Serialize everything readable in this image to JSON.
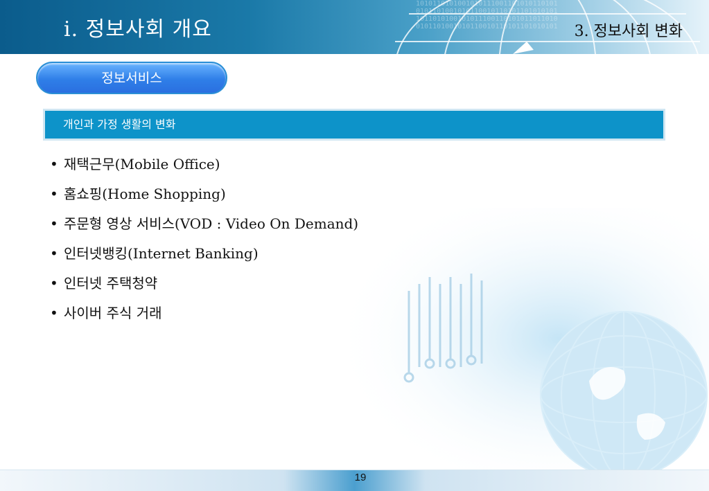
{
  "header": {
    "title": "i. 정보사회 개요",
    "subtitle": "3. 정보사회 변화"
  },
  "pill": {
    "label": "정보서비스"
  },
  "section": {
    "heading": "개인과 가정 생활의 변화"
  },
  "bullets": [
    "재택근무(Mobile Office)",
    "홈쇼핑(Home Shopping)",
    "주문형 영상 서비스(VOD : Video On Demand)",
    "인터넷뱅킹(Internet Banking)",
    "인터넷 주택청약",
    "사이버 주식 거래"
  ],
  "bullet_glyph": "•",
  "footer": {
    "page_number": "19"
  },
  "colors": {
    "header_dark": "#0b5c8c",
    "pill_blue": "#2f7fe8",
    "section_blue": "#0d93c9"
  }
}
